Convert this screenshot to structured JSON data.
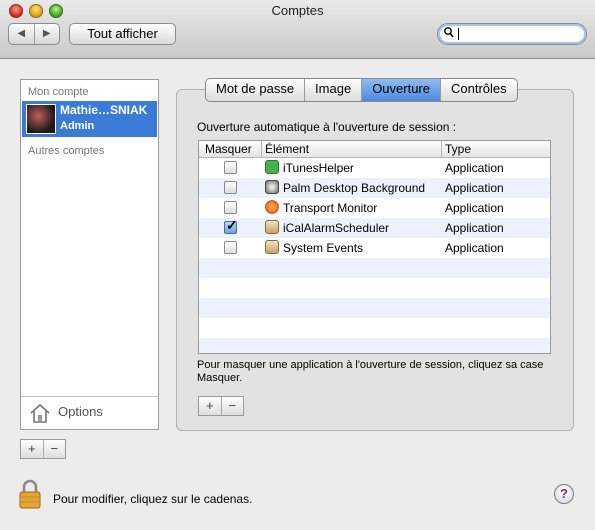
{
  "window": {
    "title": "Comptes"
  },
  "toolbar": {
    "back_label": "◀",
    "forward_label": "▶",
    "show_all_label": "Tout afficher",
    "search_value": ""
  },
  "sidebar": {
    "my_account_header": "Mon compte",
    "current_account": {
      "name": "Mathie…SNIAK",
      "role": "Admin"
    },
    "other_accounts_header": "Autres comptes",
    "options_label": "Options",
    "add_label": "+",
    "remove_label": "−"
  },
  "tabs": [
    {
      "label": "Mot de passe",
      "active": false
    },
    {
      "label": "Image",
      "active": false
    },
    {
      "label": "Ouverture",
      "active": true
    },
    {
      "label": "Contrôles",
      "active": false
    }
  ],
  "login_items": {
    "heading": "Ouverture automatique à l'ouverture de session :",
    "columns": {
      "hide": "Masquer",
      "item": "Élément",
      "type": "Type"
    },
    "rows": [
      {
        "name": "iTunesHelper",
        "type": "Application",
        "hidden": false,
        "icon": "itunes-helper-icon"
      },
      {
        "name": "Palm Desktop Background",
        "type": "Application",
        "hidden": false,
        "icon": "palm-desktop-icon"
      },
      {
        "name": "Transport Monitor",
        "type": "Application",
        "hidden": false,
        "icon": "transport-monitor-icon"
      },
      {
        "name": "iCalAlarmScheduler",
        "type": "Application",
        "hidden": true,
        "icon": "ical-alarm-icon"
      },
      {
        "name": "System Events",
        "type": "Application",
        "hidden": false,
        "icon": "system-events-icon"
      }
    ],
    "hint": "Pour masquer une application à l'ouverture de session, cliquez sa case Masquer.",
    "add_label": "+",
    "remove_label": "−"
  },
  "footer": {
    "lock_text": "Pour modifier, cliquez sur le cadenas.",
    "help_label": "?"
  },
  "colors": {
    "accent": "#3a7bd5",
    "selected_tab": "#6aa3ea"
  }
}
